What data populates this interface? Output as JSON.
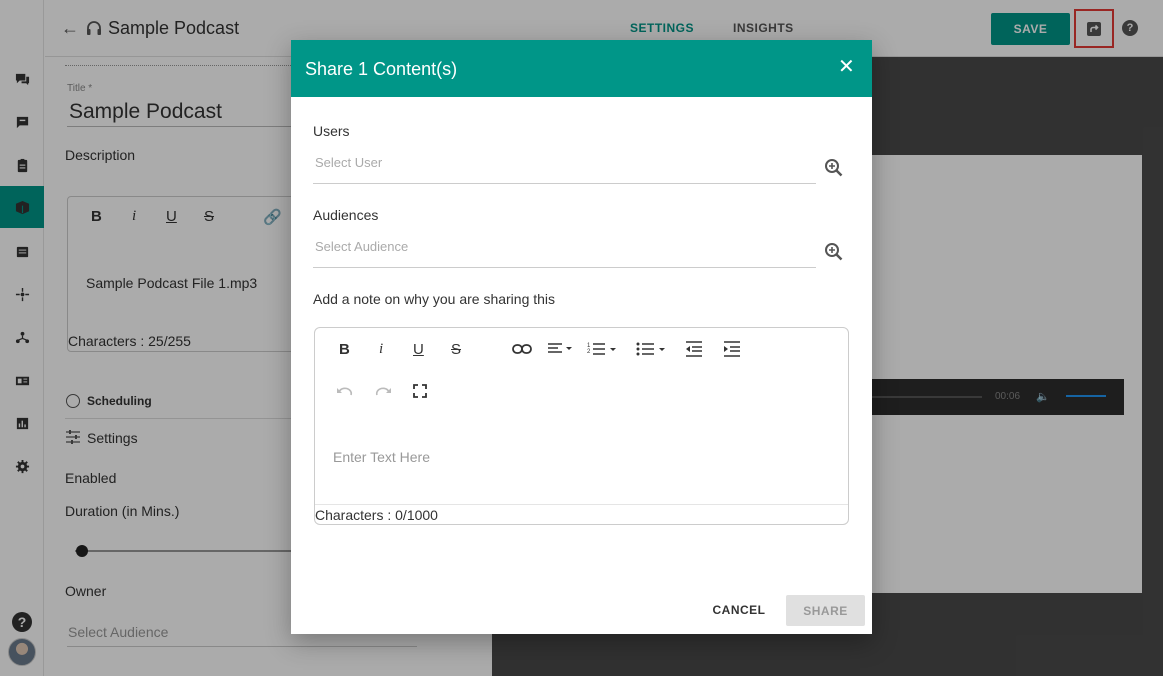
{
  "header": {
    "title": "Sample Podcast",
    "tabs": [
      {
        "label": "SETTINGS",
        "active": true
      },
      {
        "label": "INSIGHTS",
        "active": false
      }
    ],
    "save_label": "SAVE",
    "help_label": "?"
  },
  "rail": {
    "items": [
      "chat-icon",
      "message-icon",
      "clipboard-icon",
      "content-icon",
      "calendar-icon",
      "compass-icon",
      "hierarchy-icon",
      "id-card-icon",
      "analytics-icon",
      "settings-icon"
    ],
    "active_index": 3,
    "help_label": "?"
  },
  "form": {
    "title_label": "Title *",
    "title_value": "Sample Podcast",
    "description_label": "Description",
    "description_text": "Sample Podcast File 1.mp3",
    "description_chars": "Characters : 25/255",
    "scheduling_label": "Scheduling",
    "settings_label": "Settings",
    "enabled_label": "Enabled",
    "duration_label": "Duration (in Mins.)",
    "owner_label": "Owner",
    "owner_placeholder": "Select Audience"
  },
  "player": {
    "time": "00:06"
  },
  "modal": {
    "title": "Share 1 Content(s)",
    "users_label": "Users",
    "users_placeholder": "Select User",
    "audiences_label": "Audiences",
    "audiences_placeholder": "Select Audience",
    "note_label": "Add a note on why you are sharing this",
    "note_placeholder": "Enter Text Here",
    "note_chars": "Characters : 0/1000",
    "cancel_label": "CANCEL",
    "share_label": "SHARE"
  },
  "colors": {
    "accent": "#009688",
    "highlight_border": "#e53935"
  }
}
